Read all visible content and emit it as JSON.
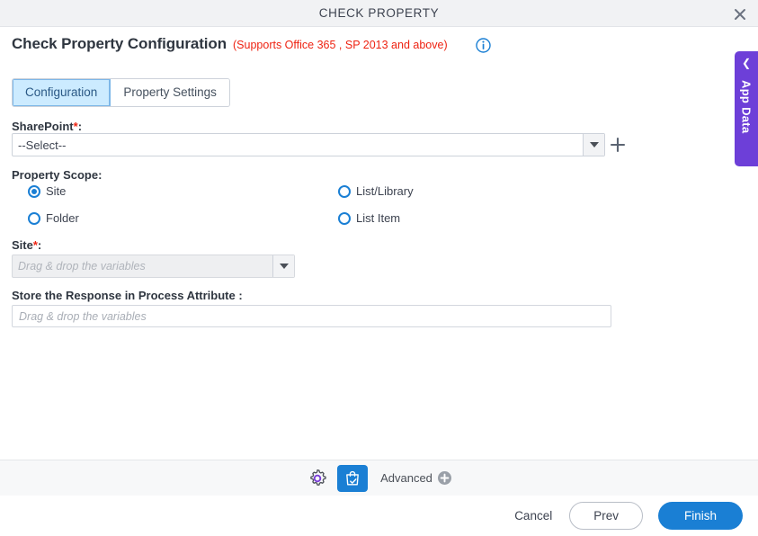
{
  "window": {
    "title": "CHECK PROPERTY",
    "close_icon": "close-icon"
  },
  "header": {
    "title": "Check Property Configuration",
    "subtitle": "(Supports Office 365 , SP 2013 and above)",
    "info_icon": "info-icon",
    "subtitle_color": "#ee2211"
  },
  "side_panel": {
    "label": "App Data",
    "chevron_icon": "chevron-left-icon",
    "color": "#6d3fd8"
  },
  "tabs": [
    {
      "label": "Configuration",
      "active": true
    },
    {
      "label": "Property Settings",
      "active": false
    }
  ],
  "form": {
    "sharepoint": {
      "label": "SharePoint",
      "required_mark": "*",
      "suffix": ":",
      "value": "--Select--",
      "dropdown_icon": "chevron-down-icon",
      "add_icon": "plus-icon"
    },
    "property_scope": {
      "label": "Property Scope:",
      "options": [
        {
          "label": "Site",
          "selected": true
        },
        {
          "label": "List/Library",
          "selected": false
        },
        {
          "label": "Folder",
          "selected": false
        },
        {
          "label": "List Item",
          "selected": false
        }
      ]
    },
    "site": {
      "label": "Site",
      "required_mark": "*",
      "suffix": ":",
      "placeholder": "Drag & drop the variables",
      "value": "",
      "disabled": true,
      "dropdown_icon": "chevron-down-icon"
    },
    "store_response": {
      "label": "Store the Response in Process Attribute :",
      "placeholder": "Drag & drop the variables",
      "value": ""
    }
  },
  "toolbar": {
    "gear_icon": "gear-icon",
    "bag_icon": "shopping-bag-check-icon",
    "advanced_label": "Advanced",
    "advanced_add_icon": "plus-circle-icon",
    "accent_color": "#1a7fd4",
    "gear_accent": "#7b3fd8"
  },
  "footer": {
    "cancel_label": "Cancel",
    "prev_label": "Prev",
    "finish_label": "Finish"
  }
}
